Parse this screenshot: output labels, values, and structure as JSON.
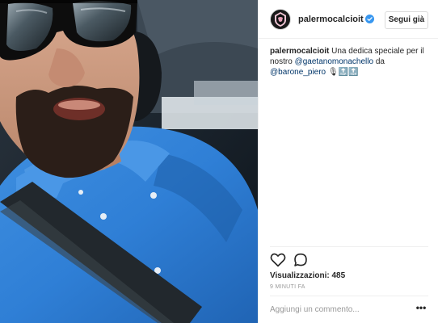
{
  "post": {
    "username": "palermocalcioit",
    "follow_label": "Segui già",
    "caption": {
      "user": "palermocalcioit",
      "text_1": "Una dedica speciale per il nostro",
      "mention_1": "@gaetanomonachello",
      "text_2": "da",
      "mention_2": "@barone_piero",
      "text_3": "🎙🔝🔝"
    },
    "views_label": "Visualizzazioni: 485",
    "timestamp": "9 MINUTI FA",
    "comment_placeholder": "Aggiungi un commento...",
    "more_label": "•••"
  },
  "icons": {
    "verified": "verified-badge-icon",
    "like": "heart-icon",
    "comment": "comment-icon",
    "avatar": "palermo-logo-icon",
    "more": "more-options-icon"
  },
  "colors": {
    "mention": "#003569",
    "verified": "#3897f0",
    "text": "#262626",
    "muted": "#999999",
    "border": "#efefef"
  }
}
